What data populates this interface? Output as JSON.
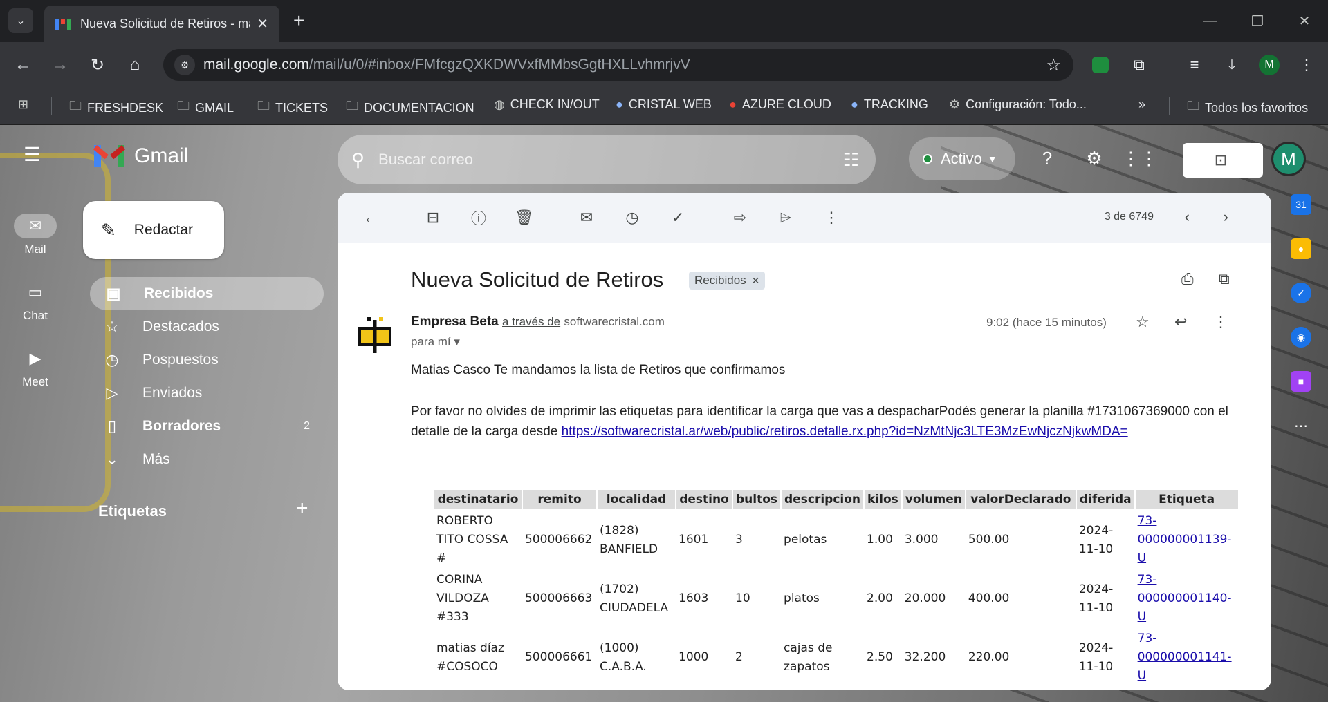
{
  "browser": {
    "tab_title": "Nueva Solicitud de Retiros - ma",
    "url_host": "mail.google.com",
    "url_path": "/mail/u/0/#inbox/FMfcgzQXKDWVxfMMbsGgtHXLLvhmrjvV",
    "profile_initial": "M",
    "bookmarks": {
      "freshdesk": "FRESHDESK",
      "gmail": "GMAIL",
      "tickets": "TICKETS",
      "documentacion": "DOCUMENTACION",
      "checkin": "CHECK IN/OUT",
      "cristal": "CRISTAL WEB",
      "azure": "AZURE CLOUD",
      "tracking": "TRACKING",
      "config": "Configuración: Todo...",
      "favoritos": "Todos los favoritos"
    }
  },
  "gmail": {
    "logo_text": "Gmail",
    "search_placeholder": "Buscar correo",
    "status": "Activo",
    "avatar_initial": "M",
    "rail": {
      "mail": "Mail",
      "chat": "Chat",
      "meet": "Meet"
    },
    "compose": "Redactar",
    "nav": {
      "inbox": "Recibidos",
      "starred": "Destacados",
      "snoozed": "Pospuestos",
      "sent": "Enviados",
      "drafts": "Borradores",
      "drafts_count": "2",
      "more": "Más"
    },
    "labels_header": "Etiquetas"
  },
  "message": {
    "pager": "3 de 6749",
    "subject": "Nueva Solicitud de Retiros",
    "label_chip": "Recibidos",
    "sender_name": "Empresa Beta",
    "via": "a través de",
    "domain": "softwarecristal.com",
    "to": "para mí",
    "time": "9:02 (hace 15 minutos)",
    "greeting": "Matias Casco Te mandamos la lista de Retiros que confirmamos",
    "body_text": "Por favor no olvides de imprimir las etiquetas para identificar la carga que vas a despacharPodés generar la planilla #1731067369000 con el detalle de la carga desde",
    "link": "https://softwarecristal.ar/web/public/retiros.detalle.rx.php?id=NzMtNjc3LTE3MzEwNjczNjkwMDA=",
    "table": {
      "headers": [
        "destinatario",
        "remito",
        "localidad",
        "destino",
        "bultos",
        "descripcion",
        "kilos",
        "volumen",
        "valorDeclarado",
        "diferida",
        "Etiqueta"
      ],
      "rows": [
        [
          "ROBERTO TITO COSSA #",
          "500006662",
          "(1828) BANFIELD",
          "1601",
          "3",
          "pelotas",
          "1.00",
          "3.000",
          "500.00",
          "2024-11-10",
          "73-000000001139-U"
        ],
        [
          "CORINA VILDOZA #333",
          "500006663",
          "(1702) CIUDADELA",
          "1603",
          "10",
          "platos",
          "2.00",
          "20.000",
          "400.00",
          "2024-11-10",
          "73-000000001140-U"
        ],
        [
          "matias díaz #COSOCO",
          "500006661",
          "(1000) C.A.B.A.",
          "1000",
          "2",
          "cajas de zapatos",
          "2.50",
          "32.200",
          "220.00",
          "2024-11-10",
          "73-000000001141-U"
        ]
      ]
    }
  }
}
